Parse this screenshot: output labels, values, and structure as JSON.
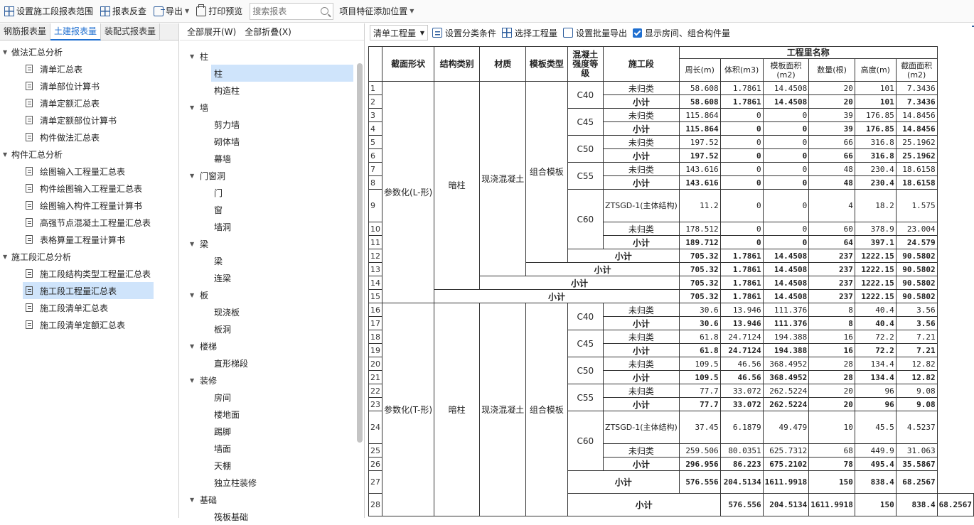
{
  "toolbar": {
    "set_range": "设置施工段报表范围",
    "report_reverse": "报表反查",
    "export": "导出",
    "print_preview": "打印预览",
    "search_placeholder": "搜索报表",
    "add_feature": "项目特征添加位置"
  },
  "left_tabs": [
    "钢筋报表量",
    "土建报表量",
    "装配式报表量"
  ],
  "left_tree": [
    {
      "label": "做法汇总分析",
      "items": [
        "清单汇总表",
        "清单部位计算书",
        "清单定额汇总表",
        "清单定额部位计算书",
        "构件做法汇总表"
      ]
    },
    {
      "label": "构件汇总分析",
      "items": [
        "绘图输入工程量汇总表",
        "构件绘图输入工程量汇总表",
        "绘图输入构件工程量计算书",
        "高强节点混凝土工程量汇总表",
        "表格算量工程量计算书"
      ]
    },
    {
      "label": "施工段汇总分析",
      "items": [
        "施工段结构类型工程量汇总表",
        "施工段工程量汇总表",
        "施工段清单汇总表",
        "施工段清单定额汇总表"
      ]
    }
  ],
  "mid_head": {
    "expand_all": "全部展开(W)",
    "collapse_all": "全部折叠(X)"
  },
  "mid_tree": [
    {
      "label": "柱",
      "items": [
        "柱",
        "构造柱"
      ]
    },
    {
      "label": "墙",
      "items": [
        "剪力墙",
        "砌体墙",
        "幕墙"
      ]
    },
    {
      "label": "门窗洞",
      "items": [
        "门",
        "窗",
        "墙洞"
      ]
    },
    {
      "label": "梁",
      "items": [
        "梁",
        "连梁"
      ]
    },
    {
      "label": "板",
      "items": [
        "现浇板",
        "板洞"
      ]
    },
    {
      "label": "楼梯",
      "items": [
        "直形梯段"
      ]
    },
    {
      "label": "装修",
      "items": [
        "房间",
        "楼地面",
        "踢脚",
        "墙面",
        "天棚",
        "独立柱装修"
      ]
    },
    {
      "label": "基础",
      "items": [
        "筏板基础"
      ]
    }
  ],
  "right_toolbar": {
    "select_value": "清单工程量",
    "set_class": "设置分类条件",
    "select_qty": "选择工程量",
    "batch_export": "设置批量导出",
    "show_room": "显示房间、组合构件量"
  },
  "table": {
    "headers": {
      "section": "截面形状",
      "struct": "结构类别",
      "material": "材质",
      "formwork": "模板类型",
      "grade": "混凝土强度等级",
      "stage": "施工段",
      "qty_name": "工程里名称",
      "perimeter": "周长(m)",
      "volume": "体积(m3)",
      "form_area": "模板面积(m2)",
      "count": "数量(根)",
      "height": "高度(m)",
      "sec_area": "截面面积(m2)"
    },
    "subtotal": "小计",
    "unassigned": "未归类",
    "ztsgd": "ZTSGD-1(主体结构)",
    "group1": {
      "section": "参数化(L-形)",
      "struct": "暗柱",
      "material": "现浇混凝土",
      "formwork": "组合模板"
    },
    "group2": {
      "section": "参数化(T-形)",
      "struct": "暗柱",
      "material": "现浇混凝土",
      "formwork": "组合模板"
    },
    "grades": [
      "C40",
      "C45",
      "C50",
      "C55",
      "C60"
    ],
    "rows": [
      [
        "58.608",
        "1.7861",
        "14.4508",
        "20",
        "101",
        "7.3436"
      ],
      [
        "58.608",
        "1.7861",
        "14.4508",
        "20",
        "101",
        "7.3436"
      ],
      [
        "115.864",
        "0",
        "0",
        "39",
        "176.85",
        "14.8456"
      ],
      [
        "115.864",
        "0",
        "0",
        "39",
        "176.85",
        "14.8456"
      ],
      [
        "197.52",
        "0",
        "0",
        "66",
        "316.8",
        "25.1962"
      ],
      [
        "197.52",
        "0",
        "0",
        "66",
        "316.8",
        "25.1962"
      ],
      [
        "143.616",
        "0",
        "0",
        "48",
        "230.4",
        "18.6158"
      ],
      [
        "143.616",
        "0",
        "0",
        "48",
        "230.4",
        "18.6158"
      ],
      [
        "11.2",
        "0",
        "0",
        "4",
        "18.2",
        "1.575"
      ],
      [
        "178.512",
        "0",
        "0",
        "60",
        "378.9",
        "23.004"
      ],
      [
        "189.712",
        "0",
        "0",
        "64",
        "397.1",
        "24.579"
      ],
      [
        "705.32",
        "1.7861",
        "14.4508",
        "237",
        "1222.15",
        "90.5802"
      ],
      [
        "705.32",
        "1.7861",
        "14.4508",
        "237",
        "1222.15",
        "90.5802"
      ],
      [
        "705.32",
        "1.7861",
        "14.4508",
        "237",
        "1222.15",
        "90.5802"
      ],
      [
        "705.32",
        "1.7861",
        "14.4508",
        "237",
        "1222.15",
        "90.5802"
      ],
      [
        "30.6",
        "13.946",
        "111.376",
        "8",
        "40.4",
        "3.56"
      ],
      [
        "30.6",
        "13.946",
        "111.376",
        "8",
        "40.4",
        "3.56"
      ],
      [
        "61.8",
        "24.7124",
        "194.388",
        "16",
        "72.2",
        "7.21"
      ],
      [
        "61.8",
        "24.7124",
        "194.388",
        "16",
        "72.2",
        "7.21"
      ],
      [
        "109.5",
        "46.56",
        "368.4952",
        "28",
        "134.4",
        "12.82"
      ],
      [
        "109.5",
        "46.56",
        "368.4952",
        "28",
        "134.4",
        "12.82"
      ],
      [
        "77.7",
        "33.072",
        "262.5224",
        "20",
        "96",
        "9.08"
      ],
      [
        "77.7",
        "33.072",
        "262.5224",
        "20",
        "96",
        "9.08"
      ],
      [
        "37.45",
        "6.1879",
        "49.479",
        "10",
        "45.5",
        "4.5237"
      ],
      [
        "259.506",
        "80.0351",
        "625.7312",
        "68",
        "449.9",
        "31.063"
      ],
      [
        "296.956",
        "86.223",
        "675.2102",
        "78",
        "495.4",
        "35.5867"
      ],
      [
        "576.556",
        "204.5134",
        "1611.9918",
        "150",
        "838.4",
        "68.2567"
      ],
      [
        "576.556",
        "204.5134",
        "1611.9918",
        "150",
        "838.4",
        "68.2567"
      ]
    ]
  }
}
